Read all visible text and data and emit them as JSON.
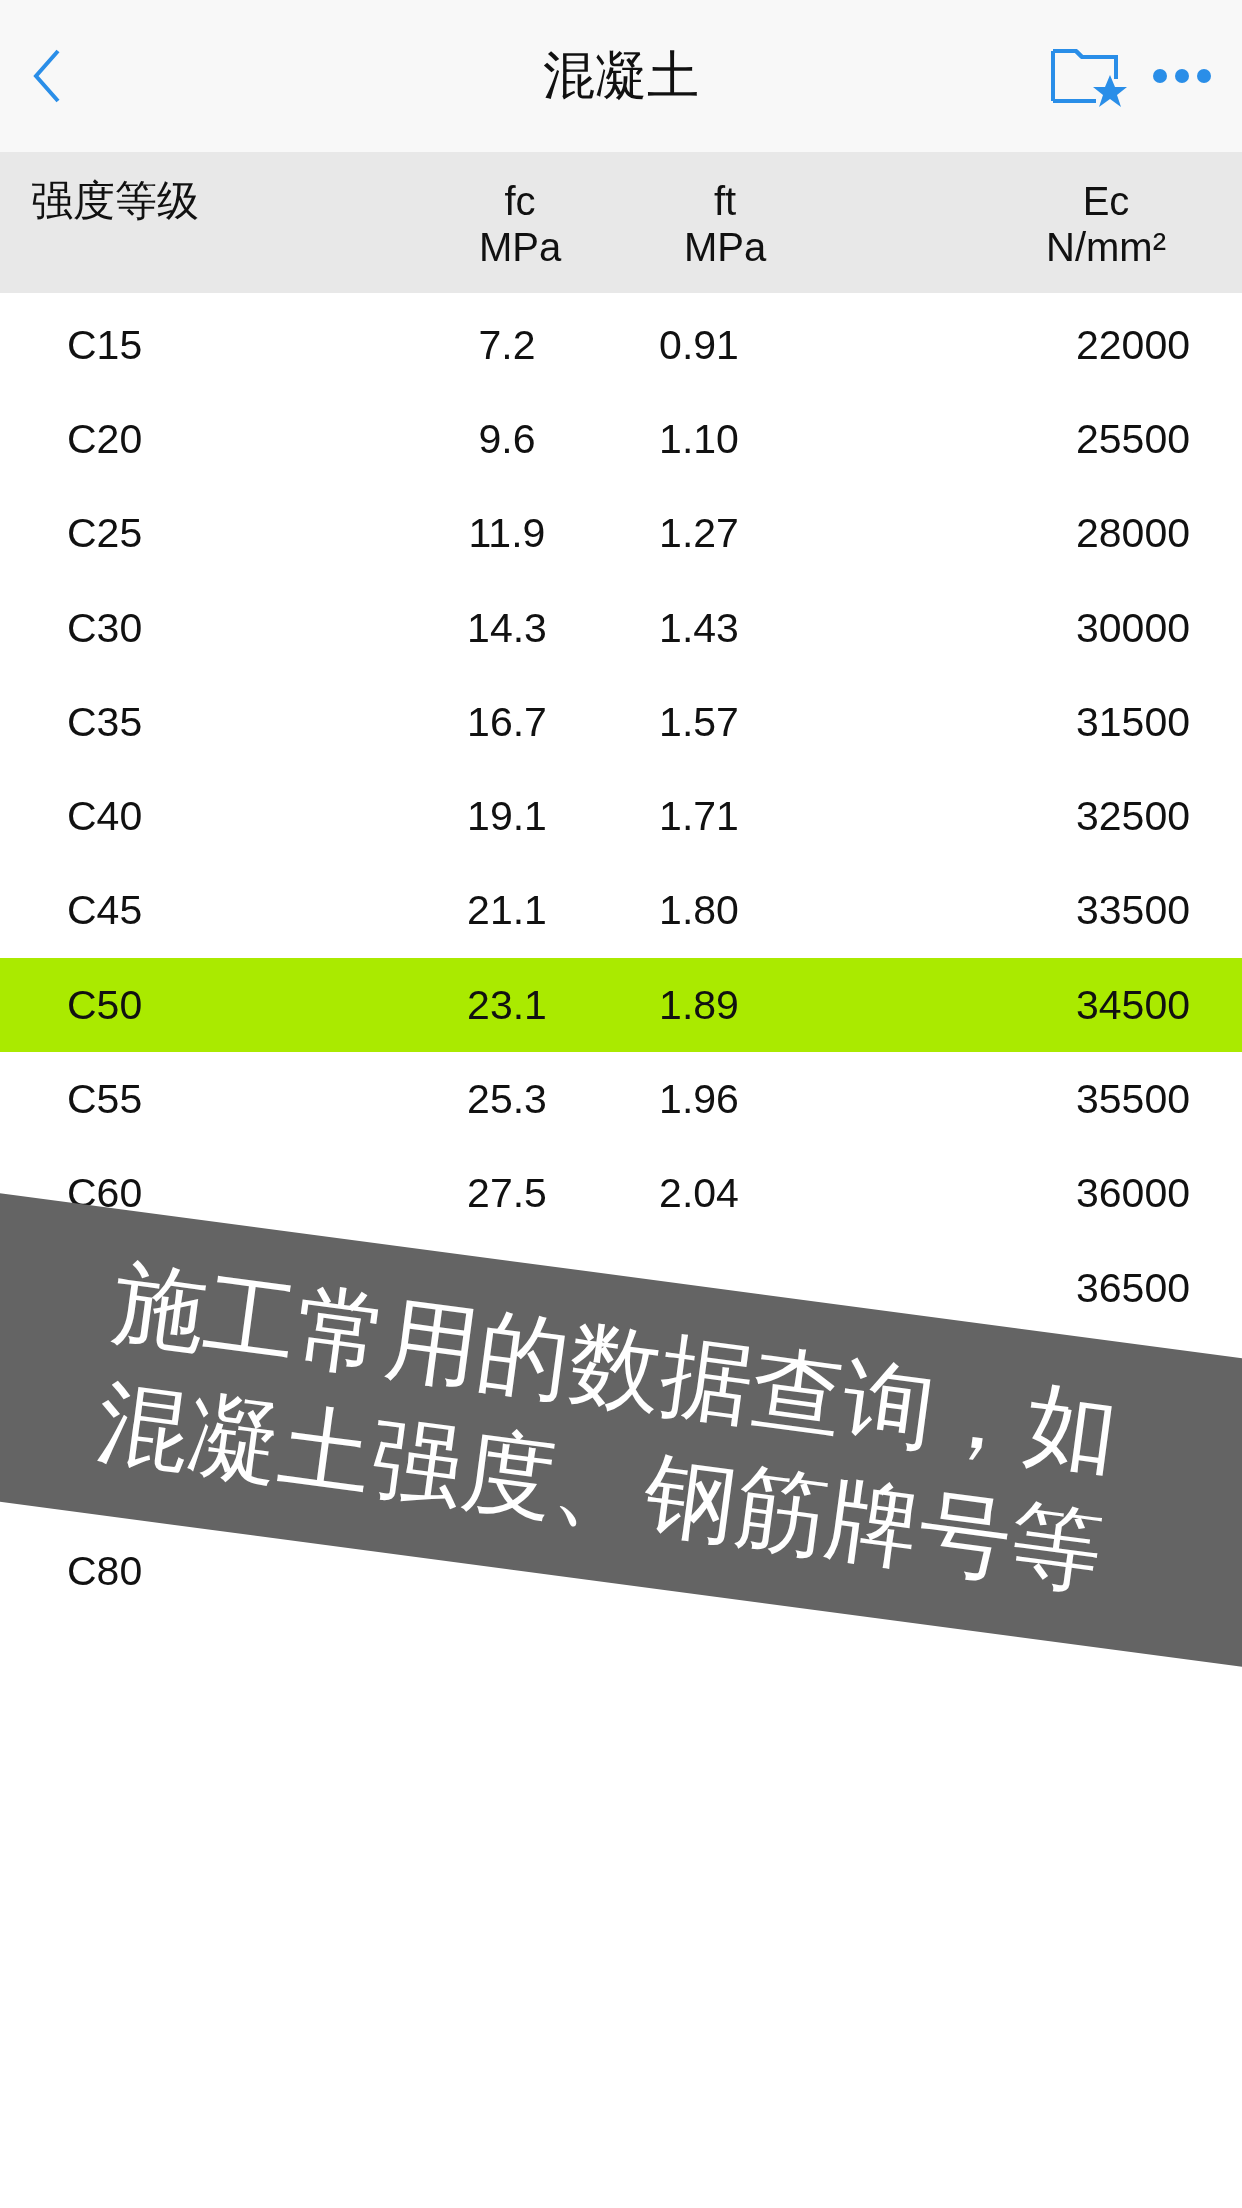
{
  "nav": {
    "title": "混凝土"
  },
  "table": {
    "columns": [
      {
        "lines": [
          "强度等级"
        ]
      },
      {
        "lines": [
          "fc",
          "MPa"
        ]
      },
      {
        "lines": [
          "ft",
          "MPa"
        ]
      },
      {
        "lines": [
          "Ec",
          "N/mm²"
        ]
      }
    ],
    "rows": [
      {
        "grade": "C15",
        "fc": "7.2",
        "ft": "0.91",
        "ec": "22000",
        "selected": false
      },
      {
        "grade": "C20",
        "fc": "9.6",
        "ft": "1.10",
        "ec": "25500",
        "selected": false
      },
      {
        "grade": "C25",
        "fc": "11.9",
        "ft": "1.27",
        "ec": "28000",
        "selected": false
      },
      {
        "grade": "C30",
        "fc": "14.3",
        "ft": "1.43",
        "ec": "30000",
        "selected": false
      },
      {
        "grade": "C35",
        "fc": "16.7",
        "ft": "1.57",
        "ec": "31500",
        "selected": false
      },
      {
        "grade": "C40",
        "fc": "19.1",
        "ft": "1.71",
        "ec": "32500",
        "selected": false
      },
      {
        "grade": "C45",
        "fc": "21.1",
        "ft": "1.80",
        "ec": "33500",
        "selected": false
      },
      {
        "grade": "C50",
        "fc": "23.1",
        "ft": "1.89",
        "ec": "34500",
        "selected": true
      },
      {
        "grade": "C55",
        "fc": "25.3",
        "ft": "1.96",
        "ec": "35500",
        "selected": false
      },
      {
        "grade": "C60",
        "fc": "27.5",
        "ft": "2.04",
        "ec": "36000",
        "selected": false
      },
      {
        "ec": "36500",
        "selected": false
      },
      {
        "grade": "C80",
        "selected": false
      }
    ]
  },
  "banner": {
    "text": "施工常用的数据查询，如混凝土强度、钢筋牌号等"
  }
}
